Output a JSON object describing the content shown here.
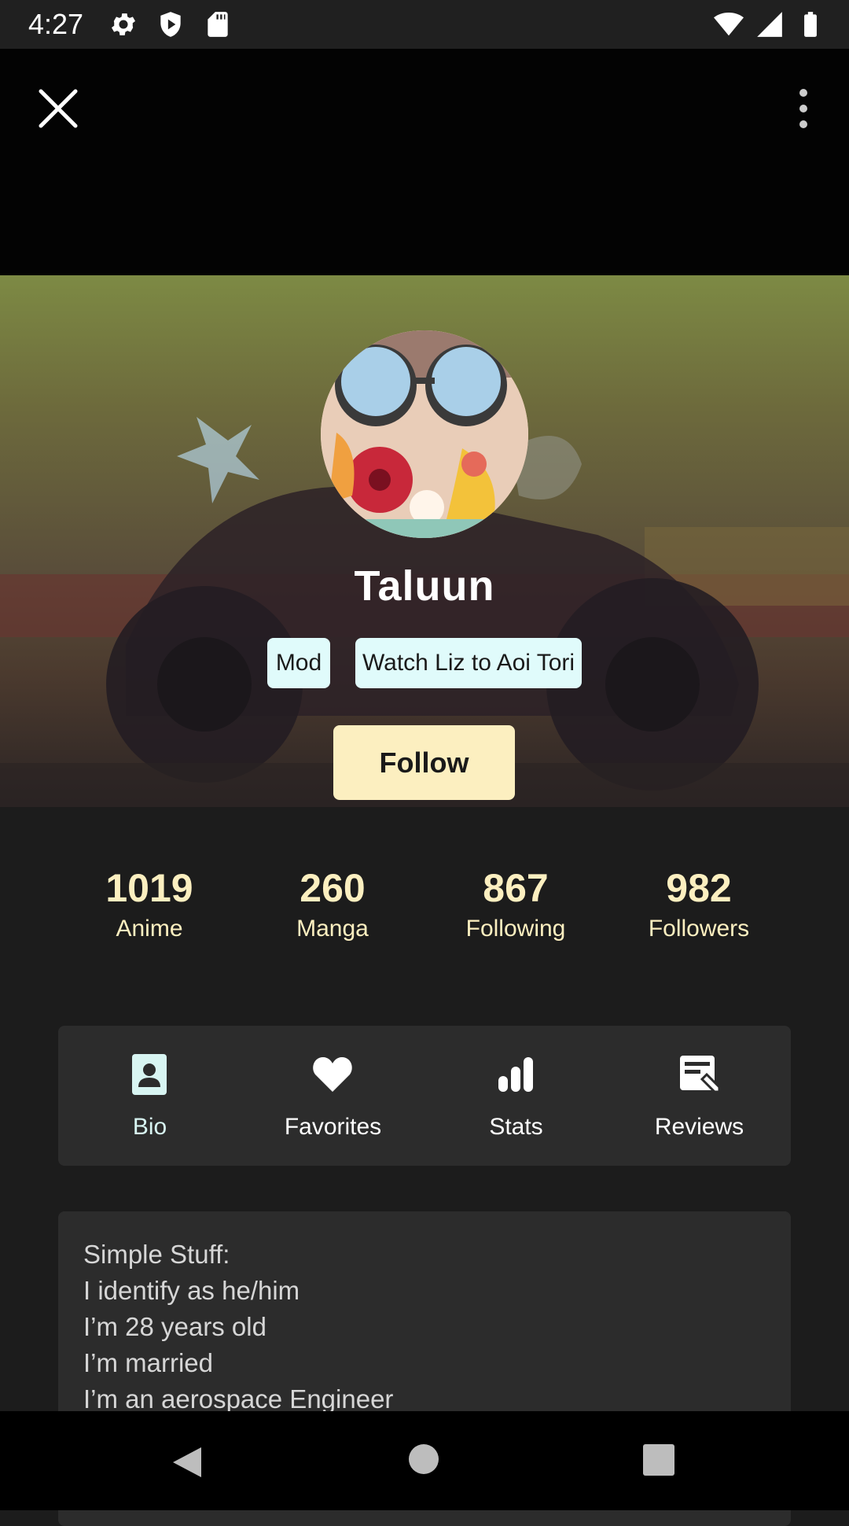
{
  "status_bar": {
    "time": "4:27",
    "left_icons": [
      "gear-icon",
      "shield-icon",
      "sd-card-icon"
    ],
    "right_icons": [
      "wifi-icon",
      "signal-icon",
      "battery-icon"
    ]
  },
  "app_bar": {
    "close_icon": "close-icon",
    "more_icon": "more-vert-icon"
  },
  "profile": {
    "username": "Taluun",
    "badges": [
      "Mod",
      "Watch Liz to Aoi Tori"
    ],
    "follow_label": "Follow"
  },
  "stats": [
    {
      "value": "1019",
      "label": "Anime"
    },
    {
      "value": "260",
      "label": "Manga"
    },
    {
      "value": "867",
      "label": "Following"
    },
    {
      "value": "982",
      "label": "Followers"
    }
  ],
  "tabs": [
    {
      "label": "Bio",
      "icon": "contact-card-icon",
      "active": true
    },
    {
      "label": "Favorites",
      "icon": "heart-icon",
      "active": false
    },
    {
      "label": "Stats",
      "icon": "bar-chart-icon",
      "active": false
    },
    {
      "label": "Reviews",
      "icon": "review-edit-icon",
      "active": false
    }
  ],
  "bio": {
    "lines": [
      "Simple Stuff:",
      "I identify as he/him",
      "I’m 28 years old",
      "I’m married",
      "I’m an aerospace Engineer"
    ]
  },
  "colors": {
    "accent": "#fcefc0",
    "badge_bg": "#e0fbfb",
    "tab_active": "#d8f5f2",
    "card_bg": "#2c2c2c",
    "page_bg": "#1c1c1c"
  },
  "nav_bar": {
    "icons": [
      "back-icon",
      "home-icon",
      "recents-icon"
    ]
  }
}
